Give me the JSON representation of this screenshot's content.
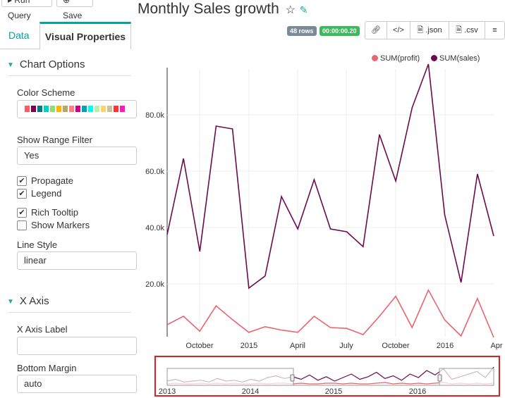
{
  "toolbar": {
    "run_query": "Run Query",
    "save": "Save"
  },
  "tabs": {
    "data": "Data",
    "visual": "Visual Properties"
  },
  "sections": {
    "chart_options": "Chart Options",
    "x_axis": "X Axis"
  },
  "fields": {
    "color_scheme": "Color Scheme",
    "color_swatches": [
      "#ff5a5f",
      "#7b0051",
      "#007a87",
      "#00d1c1",
      "#8ce071",
      "#ffb400",
      "#b4a76c",
      "#ff8083",
      "#cc0086",
      "#00a1b3",
      "#00ffeb",
      "#bbedab",
      "#ffd266",
      "#cbc29a",
      "#ff3339",
      "#ff1ab1"
    ],
    "show_range_filter": "Show Range Filter",
    "range_filter_value": "Yes",
    "propagate": "Propagate",
    "legend": "Legend",
    "rich_tooltip": "Rich Tooltip",
    "show_markers": "Show Markers",
    "line_style": "Line Style",
    "line_style_value": "linear",
    "x_axis_label": "X Axis Label",
    "x_axis_label_value": "",
    "bottom_margin": "Bottom Margin",
    "bottom_margin_value": "auto"
  },
  "checks": {
    "propagate": true,
    "legend": true,
    "rich_tooltip": true,
    "show_markers": false
  },
  "header": {
    "title": "Monthly Sales growth",
    "rows_badge": "48 rows",
    "time_badge": "00:00:00.20",
    "btn_json": ".json",
    "btn_csv": ".csv"
  },
  "colors": {
    "accent": "#00a699",
    "profit": "#e8646f",
    "sales": "#6b0a4f",
    "highlight": "#e02020"
  },
  "chart_data": {
    "type": "line",
    "series": [
      {
        "name": "SUM(sales)",
        "values": [
          37500,
          64500,
          31500,
          76000,
          75000,
          18500,
          22800,
          51000,
          39500,
          57000,
          39500,
          38500,
          33200,
          73000,
          56500,
          82500,
          98000,
          44500,
          20500,
          59000,
          37000
        ]
      },
      {
        "name": "SUM(profit)",
        "values": [
          5500,
          8500,
          3200,
          12200,
          7300,
          2800,
          4800,
          3600,
          2800,
          8500,
          4500,
          4200,
          2000,
          8500,
          15600,
          4500,
          17800,
          7200,
          1500,
          14800,
          1000
        ]
      }
    ],
    "y_ticks": [
      "20.0k",
      "40.0k",
      "60.0k",
      "80.0k"
    ],
    "x_ticks": [
      "October",
      "2015",
      "April",
      "July",
      "October",
      "2016",
      "Apr"
    ],
    "range_ticks": [
      "2013",
      "2014",
      "2015",
      "2016"
    ],
    "legend_position": "top-right"
  }
}
